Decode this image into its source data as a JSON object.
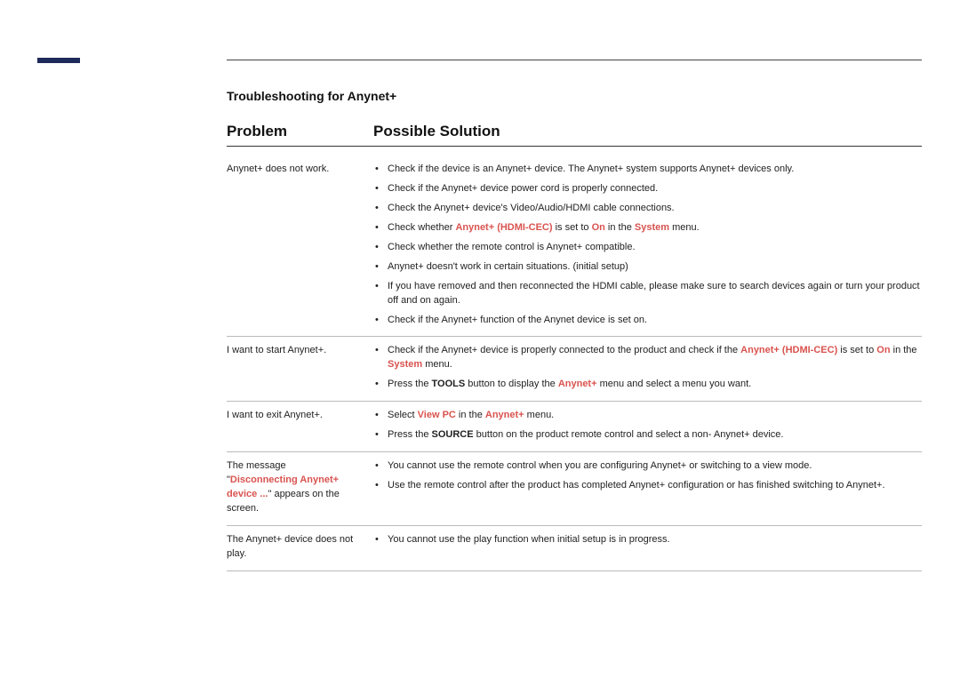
{
  "section_title": "Troubleshooting for Anynet+",
  "headers": {
    "problem": "Problem",
    "solution": "Possible Solution"
  },
  "rows": [
    {
      "problem": [
        {
          "t": "Anynet+ does not work."
        }
      ],
      "solutions": [
        [
          {
            "t": "Check if the device is an Anynet+ device. The Anynet+ system supports Anynet+ devices only."
          }
        ],
        [
          {
            "t": "Check if the Anynet+ device power cord is properly connected."
          }
        ],
        [
          {
            "t": "Check the Anynet+ device's Video/Audio/HDMI cable connections."
          }
        ],
        [
          {
            "t": "Check whether "
          },
          {
            "t": "Anynet+ (HDMI-CEC)",
            "c": "hl"
          },
          {
            "t": " is set to "
          },
          {
            "t": "On",
            "c": "hl"
          },
          {
            "t": " in the "
          },
          {
            "t": "System",
            "c": "hl"
          },
          {
            "t": " menu."
          }
        ],
        [
          {
            "t": "Check whether the remote control is Anynet+ compatible."
          }
        ],
        [
          {
            "t": "Anynet+ doesn't work in certain situations. (initial setup)"
          }
        ],
        [
          {
            "t": "If you have removed and then reconnected the HDMI cable, please make sure to search devices again or turn your product off and on again."
          }
        ],
        [
          {
            "t": "Check if the Anynet+ function of the Anynet device is set on."
          }
        ]
      ]
    },
    {
      "problem": [
        {
          "t": "I want to start Anynet+."
        }
      ],
      "solutions": [
        [
          {
            "t": "Check if the Anynet+ device is properly connected to the product and check if the "
          },
          {
            "t": "Anynet+ (HDMI-CEC)",
            "c": "hl"
          },
          {
            "t": " is set to "
          },
          {
            "t": "On",
            "c": "hl"
          },
          {
            "t": " in the "
          },
          {
            "t": "System",
            "c": "hl"
          },
          {
            "t": " menu."
          }
        ],
        [
          {
            "t": "Press the "
          },
          {
            "t": "TOOLS",
            "c": "b"
          },
          {
            "t": " button to display the "
          },
          {
            "t": "Anynet+",
            "c": "hl"
          },
          {
            "t": " menu and select a menu you want."
          }
        ]
      ]
    },
    {
      "problem": [
        {
          "t": "I want to exit Anynet+."
        }
      ],
      "solutions": [
        [
          {
            "t": "Select "
          },
          {
            "t": "View PC",
            "c": "hl"
          },
          {
            "t": " in the "
          },
          {
            "t": "Anynet+",
            "c": "hl"
          },
          {
            "t": " menu."
          }
        ],
        [
          {
            "t": "Press the "
          },
          {
            "t": "SOURCE",
            "c": "b"
          },
          {
            "t": " button on the product remote control and select a non- Anynet+ device."
          }
        ]
      ]
    },
    {
      "problem": [
        {
          "t": "The message \""
        },
        {
          "t": "Disconnecting Anynet+ device ...",
          "c": "hl"
        },
        {
          "t": "\" appears on the screen."
        }
      ],
      "solutions": [
        [
          {
            "t": "You cannot use the remote control when you are configuring Anynet+ or switching to a view mode."
          }
        ],
        [
          {
            "t": "Use the remote control after the product has completed Anynet+ configuration or has finished switching to Anynet+."
          }
        ]
      ]
    },
    {
      "problem": [
        {
          "t": "The Anynet+ device does not play."
        }
      ],
      "solutions": [
        [
          {
            "t": "You cannot use the play function when initial setup is in progress."
          }
        ]
      ]
    }
  ]
}
